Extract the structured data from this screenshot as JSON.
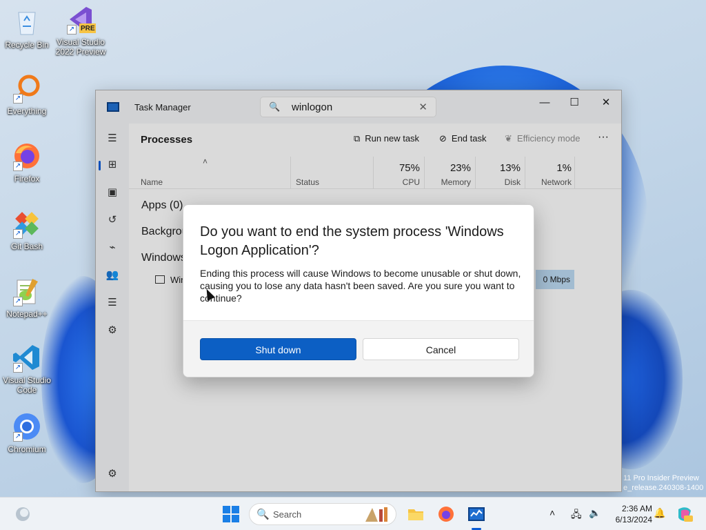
{
  "desktop": {
    "icons": [
      {
        "label": "Recycle Bin",
        "icon": "recycle-bin-icon"
      },
      {
        "label": "Visual Studio 2022 Preview",
        "icon": "visual-studio-preview-icon",
        "badge": "PRE"
      },
      {
        "label": "Everything",
        "icon": "everything-search-icon"
      },
      {
        "label": "Firefox",
        "icon": "firefox-icon"
      },
      {
        "label": "Git Bash",
        "icon": "git-bash-icon"
      },
      {
        "label": "Notepad++",
        "icon": "notepad-plus-plus-icon"
      },
      {
        "label": "Visual Studio Code",
        "icon": "vscode-icon"
      },
      {
        "label": "Chromium",
        "icon": "chromium-icon"
      }
    ],
    "shortcut_glyph": "↗",
    "watermark": [
      "11 Pro Insider Preview",
      "e_release.240308-1400"
    ]
  },
  "task_manager": {
    "title": "Task Manager",
    "search": {
      "icon": "🔍",
      "value": "winlogon",
      "clear": "✕"
    },
    "window_controls": {
      "minimize": "—",
      "maximize": "☐",
      "close": "✕"
    },
    "nav": [
      {
        "name": "hamburger-menu-icon",
        "glyph": "☰"
      },
      {
        "name": "processes-icon",
        "glyph": "⊞",
        "active": true
      },
      {
        "name": "performance-icon",
        "glyph": "▣"
      },
      {
        "name": "app-history-icon",
        "glyph": "↺"
      },
      {
        "name": "startup-apps-icon",
        "glyph": "⌁"
      },
      {
        "name": "users-icon",
        "glyph": "👥"
      },
      {
        "name": "details-icon",
        "glyph": "☰"
      },
      {
        "name": "services-icon",
        "glyph": "⚙"
      }
    ],
    "settings_glyph": "⚙",
    "page_title": "Processes",
    "toolbar": {
      "run_new_task": "Run new task",
      "run_icon": "⧉",
      "end_task": "End task",
      "end_icon": "⊘",
      "efficiency_mode": "Efficiency mode",
      "eff_icon": "❦",
      "more": "···"
    },
    "columns": {
      "sort_glyph": "˄",
      "name": "Name",
      "status": "Status",
      "cpu": {
        "pct": "75%",
        "label": "CPU"
      },
      "memory": {
        "pct": "23%",
        "label": "Memory"
      },
      "disk": {
        "pct": "13%",
        "label": "Disk"
      },
      "network": {
        "pct": "1%",
        "label": "Network"
      }
    },
    "groups": [
      "Apps (0)",
      "Backgrou",
      "Windows"
    ],
    "row": {
      "name": "Win",
      "network": "0 Mbps"
    }
  },
  "dialog": {
    "title": "Do you want to end the system process 'Windows Logon Application'?",
    "body": "Ending this process will cause Windows to become unusable or shut down, causing you to lose any data hasn't been saved. Are you sure you want to continue?",
    "primary": "Shut down",
    "secondary": "Cancel"
  },
  "taskbar": {
    "search_placeholder": "Search",
    "search_icon": "🔍",
    "tray": {
      "chevron": "˄",
      "network": "🖧",
      "volume": "🔈"
    },
    "clock": {
      "time": "2:36 AM",
      "date": "6/13/2024"
    },
    "bell": "🔔"
  },
  "colors": {
    "accent": "#0c5fc4",
    "network_highlight": "#b9d6ee"
  }
}
